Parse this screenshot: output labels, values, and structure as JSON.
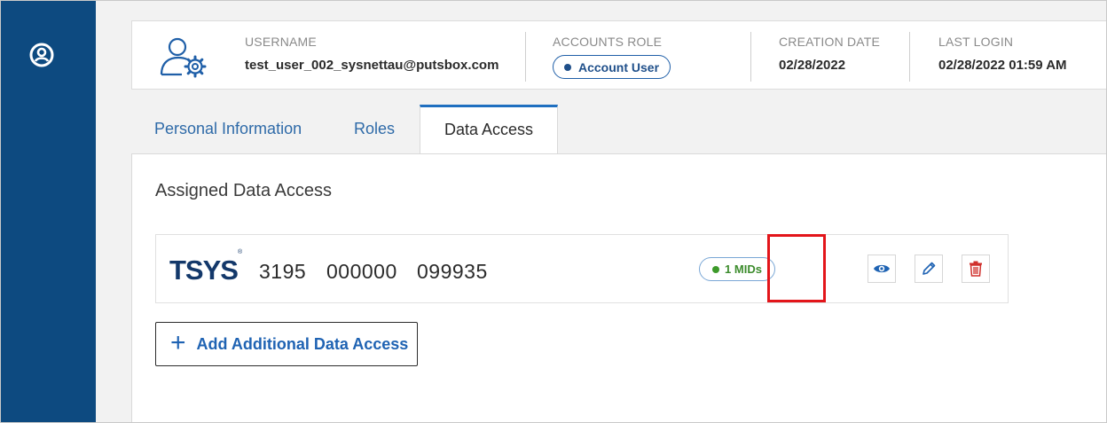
{
  "header": {
    "username_label": "USERNAME",
    "username": "test_user_002_sysnettau@putsbox.com",
    "role_label": "ACCOUNTS ROLE",
    "role": "Account User",
    "created_label": "CREATION DATE",
    "created": "02/28/2022",
    "last_login_label": "LAST LOGIN",
    "last_login": "02/28/2022 01:59 AM"
  },
  "tabs": [
    {
      "label": "Personal Information"
    },
    {
      "label": "Roles"
    },
    {
      "label": "Data Access",
      "active": true
    }
  ],
  "content": {
    "section_title": "Assigned Data Access",
    "access_row": {
      "brand": "TSYS",
      "brand_mark": "®",
      "mid_parts": [
        "3195",
        "000000",
        "099935"
      ],
      "mids_badge": "1 MIDs"
    },
    "add_button": "Add Additional Data Access"
  },
  "colors": {
    "sidebar": "#0d4a80",
    "accent": "#1f6fc0",
    "highlight": "#e3151a",
    "mids_green": "#3d9a2a",
    "delete_red": "#d0312d"
  },
  "icons": {
    "sidebar": "user-circle-icon",
    "header": "user-settings-icon",
    "view": "eye-icon",
    "edit": "pencil-icon",
    "delete": "trash-icon",
    "add": "plus-icon"
  }
}
